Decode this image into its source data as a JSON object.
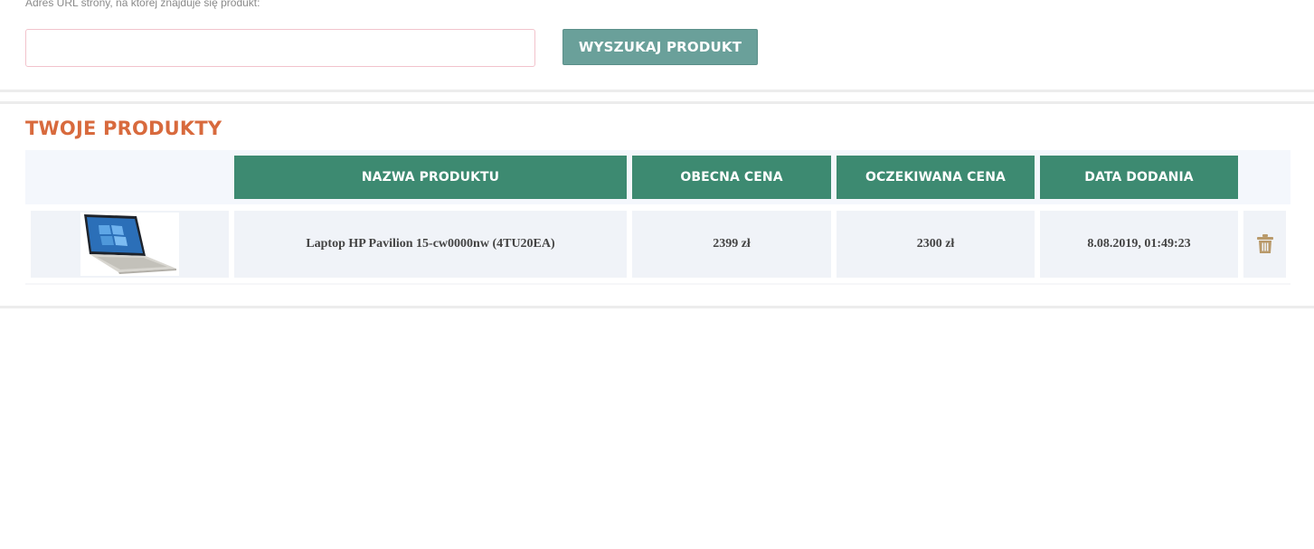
{
  "search": {
    "label": "Adres URL strony, na której znajduje się produkt:",
    "input_value": "",
    "placeholder": "",
    "button_label": "WYSZUKAJ PRODUKT"
  },
  "products": {
    "title": "TWOJE PRODUKTY",
    "columns": [
      "",
      "NAZWA PRODUKTU",
      "OBECNA CENA",
      "OCZEKIWANA CENA",
      "DATA DODANIA",
      ""
    ],
    "rows": [
      {
        "image_icon": "laptop-image",
        "name": "Laptop HP Pavilion 15-cw0000nw (4TU20EA)",
        "current_price": "2399 zł",
        "expected_price": "2300 zł",
        "date_added": "8.08.2019, 01:49:23",
        "action_icon": "trash-icon"
      }
    ]
  },
  "colors": {
    "accent_orange": "#d86a3d",
    "header_green": "#3d8a71",
    "button_teal": "#6aa09a",
    "trash_gold": "#b99a6b"
  }
}
